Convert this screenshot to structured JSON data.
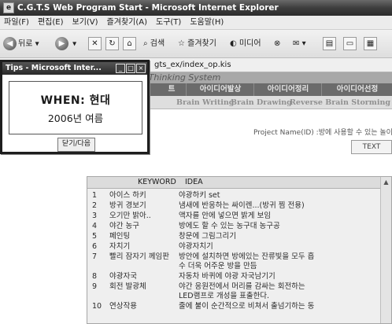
{
  "window": {
    "title": "C.G.T.S Web Program Start - Microsoft Internet Explorer",
    "icon_glyph": "e"
  },
  "menu": [
    "파일(F)",
    "편집(E)",
    "보기(V)",
    "즐겨찾기(A)",
    "도구(T)",
    "도움말(H)"
  ],
  "toolbar": {
    "back_label": "뒤로",
    "search_label": "검색",
    "favorites_label": "즐겨찾기",
    "media_label": "미디어"
  },
  "address": {
    "url_fragment": "gts_ex/index_op.kis"
  },
  "page": {
    "header_text": "roup Thinking System",
    "nav": [
      "트",
      "아이디어발상",
      "아이디어정리",
      "아이디어선정"
    ],
    "subnav": [
      "Brain Writing",
      "Brain Drawing",
      "Reverse Brain Storming"
    ],
    "project_label": "Project Name(ID) :방에 사용할 수 있는 놀이",
    "text_button": "TEXT"
  },
  "popup": {
    "title": "Tips - Microsoft Inter...",
    "line1": "WHEN: 현대",
    "line2": "2006년 여름",
    "close_label": "닫기/다음"
  },
  "ideas": {
    "col_keyword": "KEYWORD",
    "col_idea": "IDEA",
    "rows": [
      {
        "no": "1",
        "keyword": "아이스 하키",
        "idea": [
          "야광하키 set"
        ]
      },
      {
        "no": "2",
        "keyword": "방귀 경보기",
        "idea": [
          "냄새에 반응하는 싸이렌...(방귀 찜 전용)"
        ]
      },
      {
        "no": "3",
        "keyword": "오기만 밝아..",
        "idea": [
          "액자를 안에 넣으면 밝게 보임"
        ]
      },
      {
        "no": "4",
        "keyword": "야간 농구",
        "idea": [
          "방에도 할 수 있는 농구대 농구공"
        ]
      },
      {
        "no": "5",
        "keyword": "페인팅",
        "idea": [
          "창문에 그림그리기"
        ]
      },
      {
        "no": "6",
        "keyword": "자치기",
        "idea": [
          "야광자치기"
        ]
      },
      {
        "no": "7",
        "keyword": "빨리 잠자기 께임판",
        "idea": [
          "방안에 설치하면 방에있는 잔류빛을 모두 흡",
          "수 더욱 어주운 방을 만듬"
        ]
      },
      {
        "no": "8",
        "keyword": "야광자국",
        "idea": [
          "자동차 바퀴에 야광 자국남기기"
        ]
      },
      {
        "no": "9",
        "keyword": "회전 발광체",
        "idea": [
          "야간 응원전에서 머리를 감싸는 회전하는",
          "LED램프로 개성을 표출한다."
        ]
      },
      {
        "no": "10",
        "keyword": "연상작용",
        "idea": [
          "줄에 불이 순간적으로 비쳐서 출넘기하는 동"
        ]
      }
    ]
  }
}
